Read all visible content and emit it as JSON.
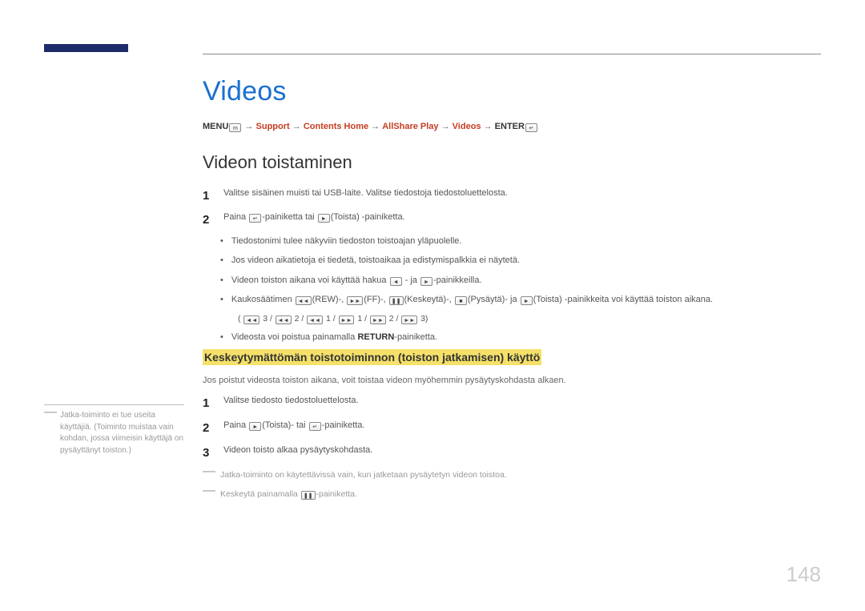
{
  "page_number": "148",
  "sidebar_note": {
    "line1": "Jatka-toiminto ei tue useita käyttäjiä.",
    "line2": "(Toiminto muistaa vain kohdan, jossa viimeisin käyttäjä on pysäyttänyt toiston.)"
  },
  "breadcrumb": {
    "menu": "MENU",
    "support": "Support",
    "contents_home": "Contents Home",
    "allshare_play": "AllShare Play",
    "videos": "Videos",
    "enter": "ENTER"
  },
  "h1": "Videos",
  "h2": "Videon toistaminen",
  "steps_a": {
    "s1": "Valitse sisäinen muisti tai USB-laite. Valitse tiedostoja tiedostoluettelosta.",
    "s2_a": "Paina ",
    "s2_b": "-painiketta tai ",
    "s2_c": "(Toista) -painiketta."
  },
  "bullets": {
    "b1": "Tiedostonimi tulee näkyviin tiedoston toistoajan yläpuolelle.",
    "b2": "Jos videon aikatietoja ei tiedetä, toistoaikaa ja edistymispalkkia ei näytetä.",
    "b3_a": "Videon toiston aikana voi käyttää hakua ",
    "b3_b": " - ja ",
    "b3_c": "-painikkeilla.",
    "b4_a": "Kaukosäätimen ",
    "b4_rew": "(REW)-, ",
    "b4_ff": "(FF)-, ",
    "b4_pause": "(Keskeytä)-, ",
    "b4_stop": "(Pysäytä)- ja ",
    "b4_play": "(Toista) -painikkeita voi käyttää toiston aikana.",
    "b4_line2_a": "( ",
    "b4_line2_b": " 3 / ",
    "b4_line2_c": " 2 / ",
    "b4_line2_d": " 1 / ",
    "b4_line2_e": " 1 / ",
    "b4_line2_f": " 2 / ",
    "b4_line2_g": " 3)",
    "b5_a": "Videosta voi poistua painamalla ",
    "b5_return": "RETURN",
    "b5_b": "-painiketta."
  },
  "highlight": "Keskeytymättömän toistotoiminnon (toiston jatkamisen) käyttö",
  "para1": "Jos poistut videosta toiston aikana, voit toistaa videon myöhemmin pysäytyskohdasta alkaen.",
  "steps_b": {
    "s1": "Valitse tiedosto tiedostoluettelosta.",
    "s2_a": "Paina ",
    "s2_b": "(Toista)- tai ",
    "s2_c": "-painiketta.",
    "s3": "Videon toisto alkaa pysäytyskohdasta."
  },
  "note1": "Jatka-toiminto on käytettävissä vain, kun jatketaan pysäytetyn videon toistoa.",
  "note2_a": "Keskeytä painamalla ",
  "note2_b": "-painiketta.",
  "icons": {
    "menu": "m",
    "enter": "↵",
    "play": "►",
    "left": "◄",
    "right": "►",
    "rew": "◄◄",
    "ff": "►►",
    "pause": "❚❚",
    "stop": "■"
  }
}
